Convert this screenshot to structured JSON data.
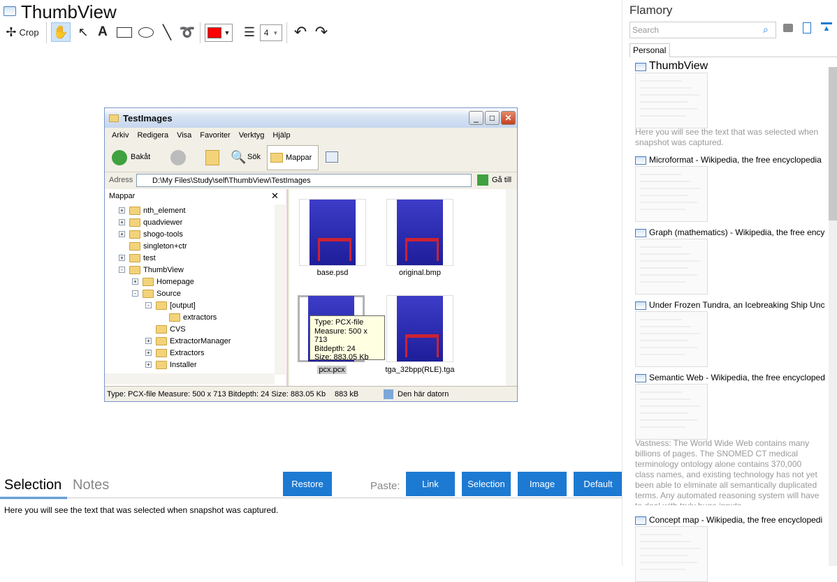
{
  "app": {
    "title": "ThumbView",
    "toolbar": {
      "crop_label": "Crop",
      "text_tool": "A",
      "line_width_value": "4"
    }
  },
  "screenshot": {
    "window_title": "TestImages",
    "menu": [
      "Arkiv",
      "Redigera",
      "Visa",
      "Favoriter",
      "Verktyg",
      "Hjälp"
    ],
    "back_label": "Bakåt",
    "search_label": "Sök",
    "folders_label": "Mappar",
    "address_label": "Adress",
    "address_value": "D:\\My Files\\Study\\self\\ThumbView\\TestImages",
    "go_label": "Gå till",
    "pane_title": "Mappar",
    "tree": [
      {
        "label": "nth_element",
        "indent": 0,
        "expander": "+"
      },
      {
        "label": "quadviewer",
        "indent": 0,
        "expander": "+"
      },
      {
        "label": "shogo-tools",
        "indent": 0,
        "expander": "+"
      },
      {
        "label": "singleton+ctr",
        "indent": 0,
        "expander": ""
      },
      {
        "label": "test",
        "indent": 0,
        "expander": "+"
      },
      {
        "label": "ThumbView",
        "indent": 0,
        "expander": "-"
      },
      {
        "label": "Homepage",
        "indent": 1,
        "expander": "+"
      },
      {
        "label": "Source",
        "indent": 1,
        "expander": "-"
      },
      {
        "label": "[output]",
        "indent": 2,
        "expander": "-"
      },
      {
        "label": "extractors",
        "indent": 3,
        "expander": ""
      },
      {
        "label": "CVS",
        "indent": 2,
        "expander": ""
      },
      {
        "label": "ExtractorManager",
        "indent": 2,
        "expander": "+"
      },
      {
        "label": "Extractors",
        "indent": 2,
        "expander": "+"
      },
      {
        "label": "Installer",
        "indent": 2,
        "expander": "+"
      }
    ],
    "thumbs": [
      "base.psd",
      "original.bmp",
      "pcx.pcx",
      "tga_32bpp(RLE).tga"
    ],
    "tooltip": [
      "Type: PCX-file",
      "Measure: 500 x 713",
      "Bitdepth: 24",
      "Size: 883.05 Kb"
    ],
    "status_main": "Type: PCX-file Measure: 500 x 713 Bitdepth: 24 Size: 883.05 Kb",
    "status_size": "883 kB",
    "status_location": "Den här datorn"
  },
  "bottom": {
    "tab_selection": "Selection",
    "tab_notes": "Notes",
    "restore": "Restore",
    "paste_label": "Paste:",
    "link": "Link",
    "selection": "Selection",
    "image": "Image",
    "default": "Default",
    "note_text": "Here you will see the text that was selected when snapshot was captured."
  },
  "flamory": {
    "title": "Flamory",
    "search_placeholder": "Search",
    "tab_personal": "Personal",
    "cards": [
      {
        "title": "ThumbView",
        "desc": "Here you will see the text that was selected when snapshot was captured."
      },
      {
        "title": "Microformat - Wikipedia, the free encyclopedia",
        "desc": ""
      },
      {
        "title": "Graph (mathematics) - Wikipedia, the free ency",
        "desc": ""
      },
      {
        "title": "Under Frozen Tundra, an Icebreaking Ship Unco",
        "desc": ""
      },
      {
        "title": "Semantic Web - Wikipedia, the free encycloped",
        "desc": "Vastness: The World Wide Web contains many billions of pages. The SNOMED CT medical terminology ontology alone contains 370,000 class names, and existing technology has not yet been able to eliminate all semantically duplicated terms. Any automated reasoning system will have to deal with truly huge inputs."
      },
      {
        "title": "Concept map - Wikipedia, the free encyclopedi",
        "desc": ""
      }
    ]
  },
  "colors": {
    "accent": "#1d7ad2",
    "pen_color": "#ff0000"
  }
}
